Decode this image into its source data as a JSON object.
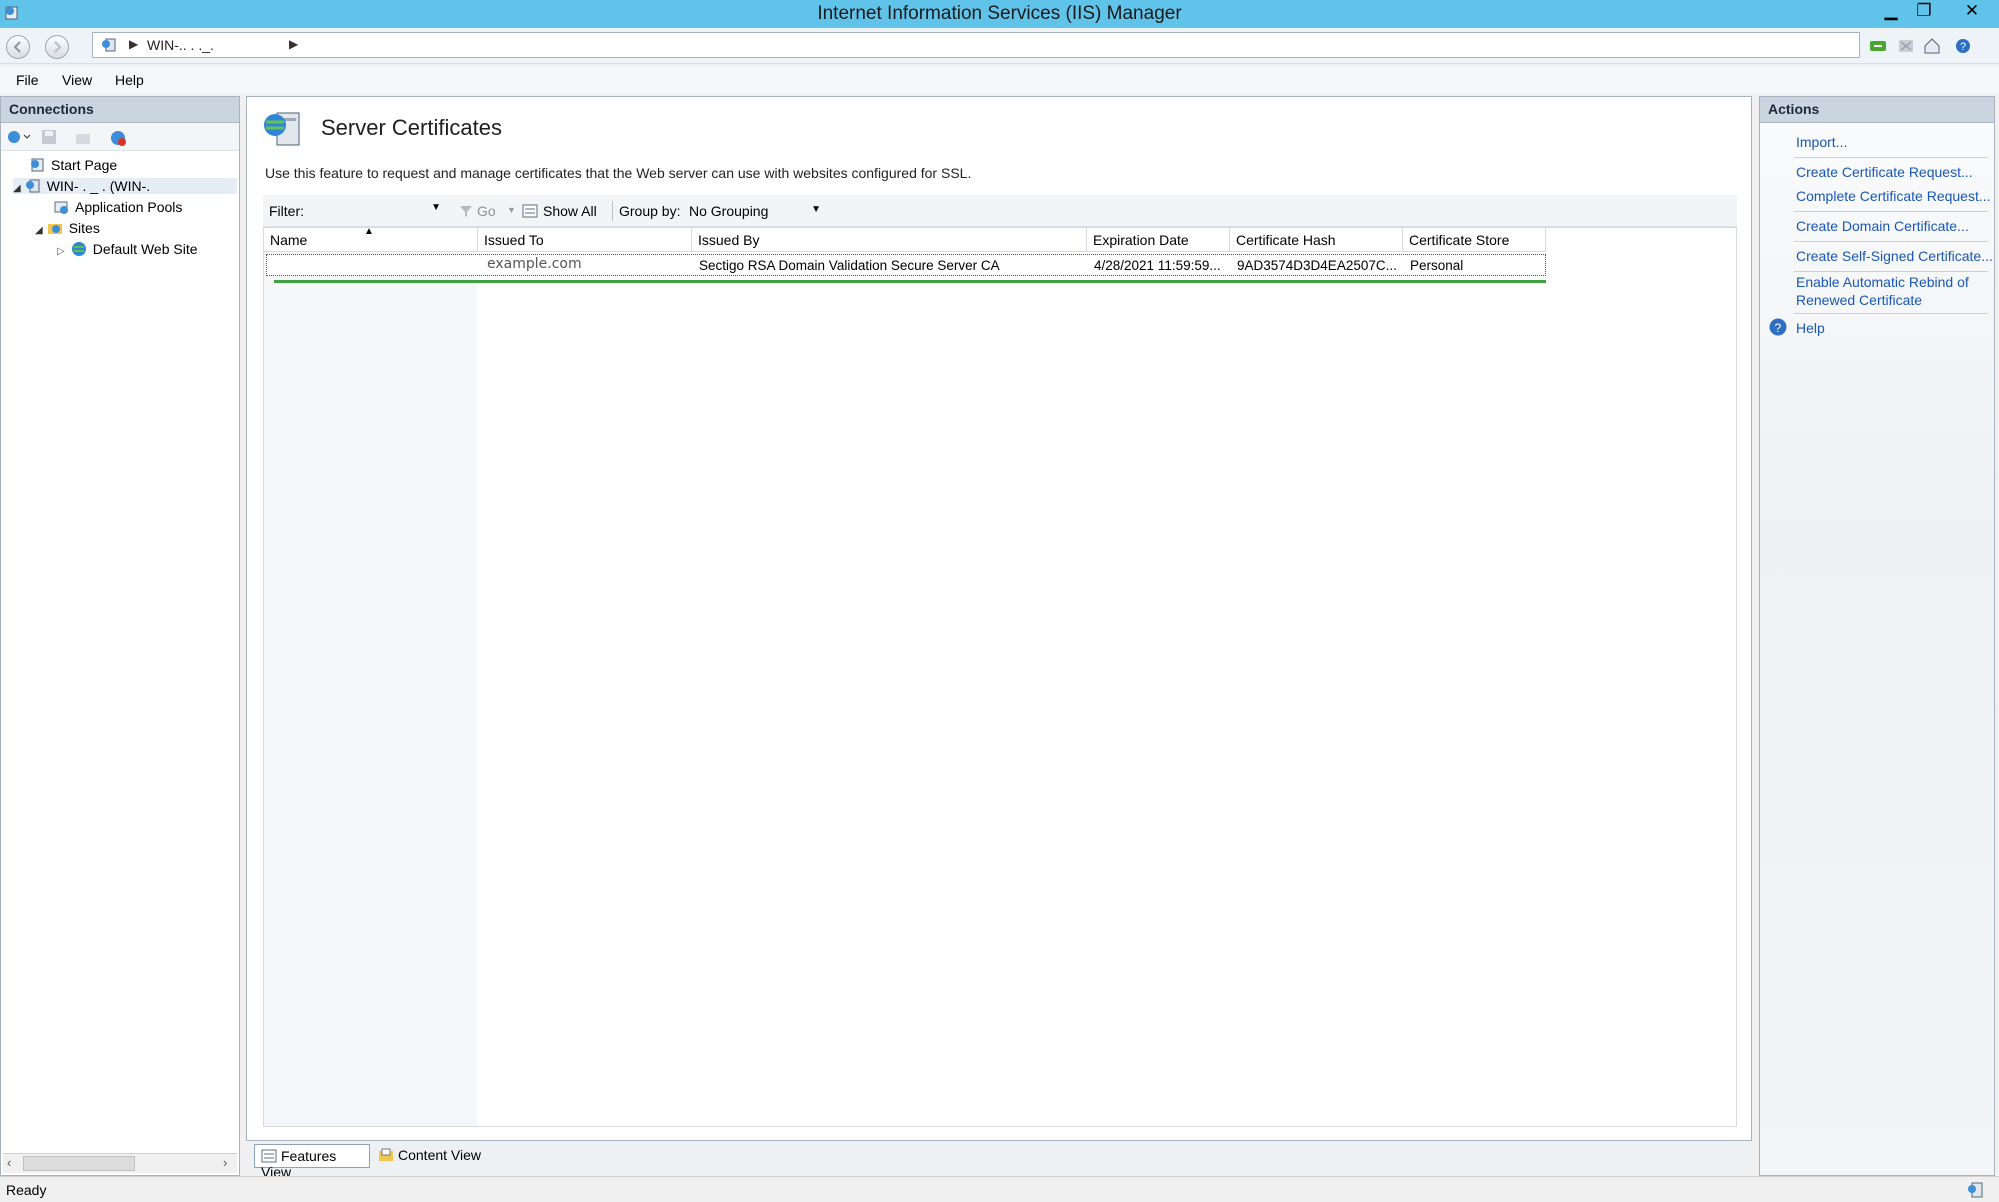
{
  "window": {
    "title": "Internet Information Services (IIS) Manager",
    "minimize": "▁",
    "restore": "❐",
    "close": "✕"
  },
  "address": {
    "breadcrumb": "WIN-..  .  ._.",
    "separator": "▶"
  },
  "menu": {
    "file": "File",
    "view": "View",
    "help": "Help"
  },
  "connections": {
    "title": "Connections",
    "tree": {
      "start_page": "Start Page",
      "server": "WIN-  .       _    .    (WIN-.",
      "app_pools": "Application Pools",
      "sites": "Sites",
      "default_site": "Default Web Site"
    }
  },
  "main": {
    "title": "Server Certificates",
    "description": "Use this feature to request and manage certificates that the Web server can use with websites configured for SSL.",
    "filter_label": "Filter:",
    "filter_value": "",
    "go_label": "Go",
    "show_all_label": "Show All",
    "group_by_label": "Group by:",
    "group_by_value": "No Grouping",
    "columns": [
      "Name",
      "Issued To",
      "Issued By",
      "Expiration Date",
      "Certificate Hash",
      "Certificate Store"
    ],
    "rows": [
      {
        "name": "",
        "issued_to": "example.com",
        "issued_by": "Sectigo RSA Domain Validation Secure Server CA",
        "expiration": "4/28/2021 11:59:59...",
        "hash": "9AD3574D3D4EA2507C...",
        "store": "Personal"
      }
    ]
  },
  "bottom_tabs": {
    "features_view": "Features View",
    "content_view": "Content View"
  },
  "actions": {
    "title": "Actions",
    "import": "Import...",
    "create_request": "Create Certificate Request...",
    "complete_request": "Complete Certificate Request...",
    "create_domain": "Create Domain Certificate...",
    "create_self_signed": "Create Self-Signed Certificate...",
    "auto_rebind_line1": "Enable Automatic Rebind of",
    "auto_rebind_line2": "Renewed Certificate",
    "help": "Help"
  },
  "status": {
    "text": "Ready"
  },
  "colors": {
    "titlebar": "#5fc3ea",
    "link": "#1a57b7",
    "accent_green": "#3ea23e"
  }
}
